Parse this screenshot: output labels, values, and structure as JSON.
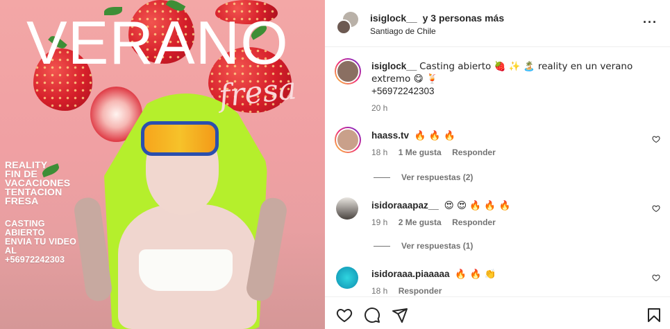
{
  "media": {
    "title": "VERANO",
    "subtitle": "fresa",
    "promo_lines": [
      "REALITY",
      "FIN DE",
      "VACACIONES",
      "TENTACION",
      "FRESA"
    ],
    "casting_lines": [
      "CASTING",
      "ABIERTO",
      "ENVIA TU VIDEO",
      "AL",
      "+56972242303"
    ]
  },
  "header": {
    "username": "isiglock__",
    "others": "y 3 personas más",
    "location": "Santiago de Chile",
    "more_icon": "···"
  },
  "caption": {
    "username": "isiglock__",
    "text": "Casting abierto 🍓 ✨ 🏝️ reality en un verano extremo 😋 🍹",
    "phone": "+56972242303",
    "time": "20 h"
  },
  "comments": [
    {
      "username": "haass.tv",
      "text": "🔥 🔥 🔥",
      "time": "18 h",
      "likes": "1 Me gusta",
      "reply": "Responder",
      "view_replies": "Ver respuestas (2)"
    },
    {
      "username": "isidoraaapaz__",
      "text": "😍 😍 🔥 🔥 🔥",
      "time": "19 h",
      "likes": "2 Me gusta",
      "reply": "Responder",
      "view_replies": "Ver respuestas (1)"
    },
    {
      "username": "isidoraaa.piaaaaa",
      "text": "🔥 🔥 👏",
      "time": "18 h",
      "reply": "Responder"
    }
  ],
  "colors": {
    "accent_ring": "#ee2a7b",
    "muted": "#737373",
    "text": "#262626"
  }
}
